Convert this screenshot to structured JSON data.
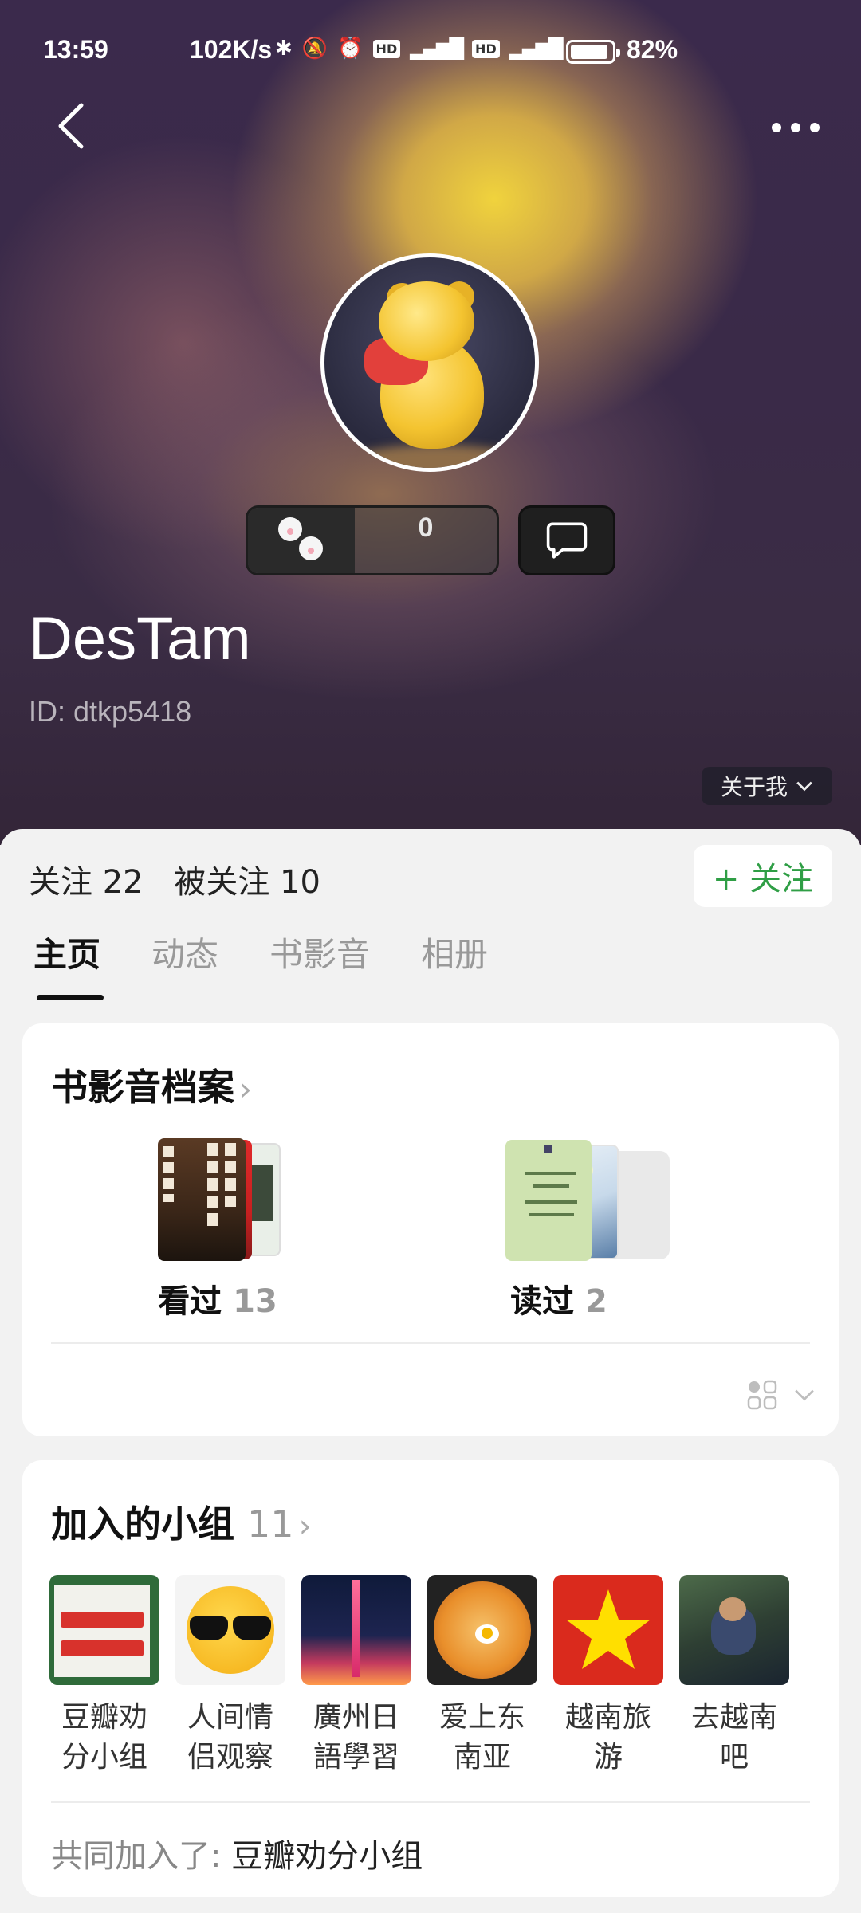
{
  "status": {
    "time": "13:59",
    "speed": "102K/s",
    "battery_pct": "82%",
    "battery_level": 0.82,
    "icons": [
      "bluetooth-icon",
      "mute-icon",
      "alarm-icon",
      "hd-icon",
      "signal-4g-icon",
      "hd-icon",
      "signal-4g-icon",
      "battery-icon"
    ]
  },
  "profile": {
    "name": "DesTam",
    "id_text": "ID: dtkp5418",
    "paw_count": "0",
    "about_label": "关于我"
  },
  "follow": {
    "following_label": "关注 22",
    "followers_label": "被关注 10",
    "follow_button": "+ 关注"
  },
  "tabs": [
    {
      "label": "主页",
      "active": true
    },
    {
      "label": "动态",
      "active": false
    },
    {
      "label": "书影音",
      "active": false
    },
    {
      "label": "相册",
      "active": false
    }
  ],
  "media_archive": {
    "title": "书影音档案",
    "watched": {
      "label": "看过",
      "count": "13"
    },
    "read": {
      "label": "读过",
      "count": "2"
    }
  },
  "groups": {
    "title": "加入的小组",
    "count": "11",
    "items": [
      {
        "name": "豆瓣劝分小组"
      },
      {
        "name": "人间情侣观察"
      },
      {
        "name": "廣州日語學習"
      },
      {
        "name": "爱上东南亚"
      },
      {
        "name": "越南旅游"
      },
      {
        "name": "去越南吧"
      }
    ],
    "common_label": "共同加入了: ",
    "common_group": "豆瓣劝分小组"
  },
  "colors": {
    "accent_green": "#2f9e45",
    "hero_bg": "#3b2a4c"
  }
}
